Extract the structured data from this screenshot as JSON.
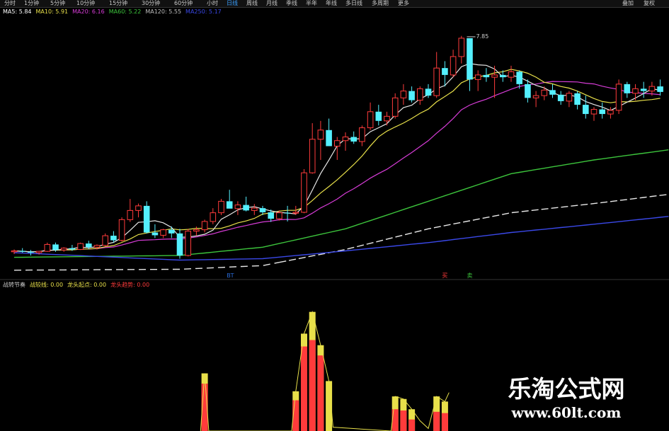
{
  "toolbar": {
    "items": [
      "分时",
      "1分钟",
      "5分钟",
      "10分钟",
      "15分钟",
      "30分钟",
      "60分钟",
      "小时",
      "日线",
      "周线",
      "月线",
      "季线",
      "半年",
      "年线",
      "多日线",
      "多周期",
      "更多"
    ],
    "active_index": 8,
    "right": [
      "叠加",
      "复权"
    ]
  },
  "legend_top": [
    {
      "text": "MA5: 5.84",
      "color": "#ffffff"
    },
    {
      "text": "MA10: 5.91",
      "color": "#e8e04a"
    },
    {
      "text": "MA20: 6.16",
      "color": "#d63cd6"
    },
    {
      "text": "MA60: 5.22",
      "color": "#3cc43c"
    },
    {
      "text": "MA120: 5.55",
      "color": "#bfbfbf"
    },
    {
      "text": "MA250: 5.17",
      "color": "#3a48e8"
    }
  ],
  "legend_bottom": [
    {
      "text": "战转节奏",
      "color": "#c8c8c8"
    },
    {
      "text": "战较线: 0.00",
      "color": "#e8e04a"
    },
    {
      "text": "龙头起点: 0.00",
      "color": "#e8e04a"
    },
    {
      "text": "龙头趋势: 0.00",
      "color": "#ff3b3b"
    }
  ],
  "chart_data": [
    {
      "type": "candlestick",
      "annotations": [
        {
          "text": "7.85",
          "x": 55
        }
      ],
      "marker_labels": [
        {
          "text": "BT",
          "x": 26,
          "color": "#2a6bd8"
        },
        {
          "text": "买",
          "x": 52,
          "color": "#ff3b3b"
        },
        {
          "text": "卖",
          "x": 55,
          "color": "#3cc43c"
        }
      ],
      "candles": [
        [
          3.2,
          3.25,
          3.15,
          3.22
        ],
        [
          3.22,
          3.28,
          3.18,
          3.2
        ],
        [
          3.2,
          3.24,
          3.12,
          3.18
        ],
        [
          3.18,
          3.22,
          3.14,
          3.21
        ],
        [
          3.21,
          3.4,
          3.2,
          3.36
        ],
        [
          3.36,
          3.4,
          3.2,
          3.24
        ],
        [
          3.24,
          3.3,
          3.2,
          3.28
        ],
        [
          3.28,
          3.35,
          3.22,
          3.25
        ],
        [
          3.25,
          3.4,
          3.24,
          3.38
        ],
        [
          3.38,
          3.44,
          3.26,
          3.3
        ],
        [
          3.3,
          3.36,
          3.25,
          3.34
        ],
        [
          3.34,
          3.6,
          3.32,
          3.55
        ],
        [
          3.55,
          3.65,
          3.4,
          3.45
        ],
        [
          3.45,
          3.95,
          3.42,
          3.9
        ],
        [
          3.9,
          4.35,
          3.85,
          4.1
        ],
        [
          4.1,
          4.25,
          3.95,
          4.2
        ],
        [
          4.2,
          4.3,
          3.6,
          3.62
        ],
        [
          3.62,
          3.8,
          3.5,
          3.56
        ],
        [
          3.56,
          3.7,
          3.5,
          3.68
        ],
        [
          3.68,
          3.75,
          3.5,
          3.6
        ],
        [
          3.6,
          3.7,
          3.05,
          3.12
        ],
        [
          3.12,
          3.7,
          3.1,
          3.65
        ],
        [
          3.65,
          3.75,
          3.55,
          3.68
        ],
        [
          3.68,
          3.9,
          3.62,
          3.86
        ],
        [
          3.86,
          4.15,
          3.8,
          4.05
        ],
        [
          4.05,
          4.35,
          4.0,
          4.3
        ],
        [
          4.3,
          4.55,
          4.25,
          4.14
        ],
        [
          4.14,
          4.3,
          4.0,
          4.22
        ],
        [
          4.22,
          4.4,
          4.08,
          4.1
        ],
        [
          4.1,
          4.24,
          4.0,
          4.15
        ],
        [
          4.15,
          4.2,
          4.0,
          4.06
        ],
        [
          4.06,
          4.12,
          3.85,
          3.92
        ],
        [
          3.92,
          4.1,
          3.88,
          4.05
        ],
        [
          4.05,
          4.2,
          3.86,
          4.04
        ],
        [
          4.04,
          4.2,
          4.0,
          4.06
        ],
        [
          4.06,
          5.0,
          4.04,
          4.92
        ],
        [
          4.92,
          6.0,
          4.9,
          5.65
        ],
        [
          5.65,
          6.05,
          5.2,
          5.85
        ],
        [
          5.85,
          6.1,
          5.5,
          5.5
        ],
        [
          5.5,
          5.7,
          5.2,
          5.62
        ],
        [
          5.62,
          5.8,
          5.4,
          5.7
        ],
        [
          5.7,
          5.82,
          5.55,
          5.6
        ],
        [
          5.6,
          5.95,
          5.5,
          5.9
        ],
        [
          5.9,
          6.45,
          5.85,
          6.25
        ],
        [
          6.25,
          6.4,
          5.95,
          6.05
        ],
        [
          6.05,
          6.25,
          5.95,
          6.15
        ],
        [
          6.15,
          6.65,
          6.1,
          6.55
        ],
        [
          6.55,
          6.85,
          6.4,
          6.7
        ],
        [
          6.7,
          6.8,
          6.45,
          6.5
        ],
        [
          6.5,
          6.8,
          6.4,
          6.75
        ],
        [
          6.75,
          6.85,
          6.55,
          6.6
        ],
        [
          6.6,
          7.55,
          6.55,
          7.2
        ],
        [
          7.2,
          7.35,
          6.8,
          7.05
        ],
        [
          7.05,
          7.6,
          7.0,
          7.45
        ],
        [
          7.45,
          7.9,
          7.3,
          7.85
        ],
        [
          7.85,
          7.85,
          6.7,
          6.95
        ],
        [
          6.95,
          7.15,
          6.7,
          7.05
        ],
        [
          7.05,
          7.2,
          6.9,
          7.0
        ],
        [
          7.0,
          7.25,
          6.55,
          7.05
        ],
        [
          7.05,
          7.15,
          6.9,
          7.0
        ],
        [
          7.0,
          7.25,
          6.9,
          7.12
        ],
        [
          7.12,
          7.15,
          6.75,
          6.85
        ],
        [
          6.85,
          6.95,
          6.45,
          6.55
        ],
        [
          6.55,
          6.7,
          6.35,
          6.6
        ],
        [
          6.6,
          6.8,
          6.5,
          6.72
        ],
        [
          6.72,
          6.85,
          6.55,
          6.62
        ],
        [
          6.62,
          6.7,
          6.4,
          6.48
        ],
        [
          6.48,
          6.7,
          6.35,
          6.65
        ],
        [
          6.65,
          6.7,
          6.3,
          6.4
        ],
        [
          6.4,
          6.6,
          6.1,
          6.2
        ],
        [
          6.2,
          6.35,
          6.05,
          6.3
        ],
        [
          6.3,
          6.45,
          6.1,
          6.2
        ],
        [
          6.2,
          6.35,
          6.1,
          6.28
        ],
        [
          6.28,
          6.95,
          6.2,
          6.85
        ],
        [
          6.85,
          6.9,
          6.55,
          6.65
        ],
        [
          6.65,
          6.85,
          6.5,
          6.75
        ],
        [
          6.75,
          6.9,
          6.55,
          6.7
        ],
        [
          6.7,
          6.9,
          6.6,
          6.8
        ],
        [
          6.8,
          6.95,
          6.6,
          6.68
        ]
      ],
      "ma_long": [
        {
          "name": "MA60",
          "color": "#3cc43c",
          "points": [
            [
              0,
              3.08
            ],
            [
              20,
              3.12
            ],
            [
              30,
              3.3
            ],
            [
              40,
              3.7
            ],
            [
              50,
              4.3
            ],
            [
              60,
              4.9
            ],
            [
              70,
              5.2
            ],
            [
              79,
              5.42
            ]
          ]
        },
        {
          "name": "MA120",
          "color": "#e8e8e8",
          "dashed_until": 32,
          "points": [
            [
              0,
              2.8
            ],
            [
              20,
              2.82
            ],
            [
              30,
              2.9
            ],
            [
              40,
              3.25
            ],
            [
              50,
              3.7
            ],
            [
              60,
              4.05
            ],
            [
              70,
              4.25
            ],
            [
              79,
              4.45
            ]
          ]
        },
        {
          "name": "MA250",
          "color": "#3a48e8",
          "points": [
            [
              0,
              3.18
            ],
            [
              20,
              3.02
            ],
            [
              30,
              3.05
            ],
            [
              40,
              3.22
            ],
            [
              50,
              3.4
            ],
            [
              60,
              3.62
            ],
            [
              70,
              3.8
            ],
            [
              79,
              3.97
            ]
          ]
        }
      ]
    },
    {
      "type": "bar",
      "series": [
        {
          "name": "龙头起点",
          "color": "#e8e04a"
        },
        {
          "name": "龙头趋势",
          "color": "#ff3b3b"
        }
      ],
      "ylim": [
        0,
        100
      ],
      "bars": [
        {
          "x": 23,
          "yellow": 45,
          "red": 37
        },
        {
          "x": 34,
          "yellow": 31,
          "red": 24
        },
        {
          "x": 35,
          "yellow": 76,
          "red": 66
        },
        {
          "x": 36,
          "yellow": 93,
          "red": 71
        },
        {
          "x": 37,
          "yellow": 67,
          "red": 59
        },
        {
          "x": 38,
          "yellow": 39,
          "red": 0
        },
        {
          "x": 46,
          "yellow": 27,
          "red": 17
        },
        {
          "x": 47,
          "yellow": 25,
          "red": 16
        },
        {
          "x": 48,
          "yellow": 17,
          "red": 9
        },
        {
          "x": 51,
          "yellow": 27,
          "red": 15
        },
        {
          "x": 52,
          "yellow": 23,
          "red": 14
        }
      ],
      "line_points": [
        [
          22.5,
          0
        ],
        [
          23,
          45
        ],
        [
          23.5,
          0
        ],
        [
          33.5,
          0
        ],
        [
          34,
          31
        ],
        [
          35,
          76
        ],
        [
          36,
          93
        ],
        [
          37,
          67
        ],
        [
          38,
          39
        ],
        [
          38.5,
          3
        ],
        [
          45.5,
          0
        ],
        [
          46,
          27
        ],
        [
          47,
          25
        ],
        [
          48,
          17
        ],
        [
          49,
          8
        ],
        [
          50,
          2
        ],
        [
          51,
          27
        ],
        [
          52,
          23
        ],
        [
          52.5,
          30
        ]
      ]
    }
  ],
  "watermark": {
    "line1": "乐淘公式网",
    "line2": "www.60lt.com"
  }
}
